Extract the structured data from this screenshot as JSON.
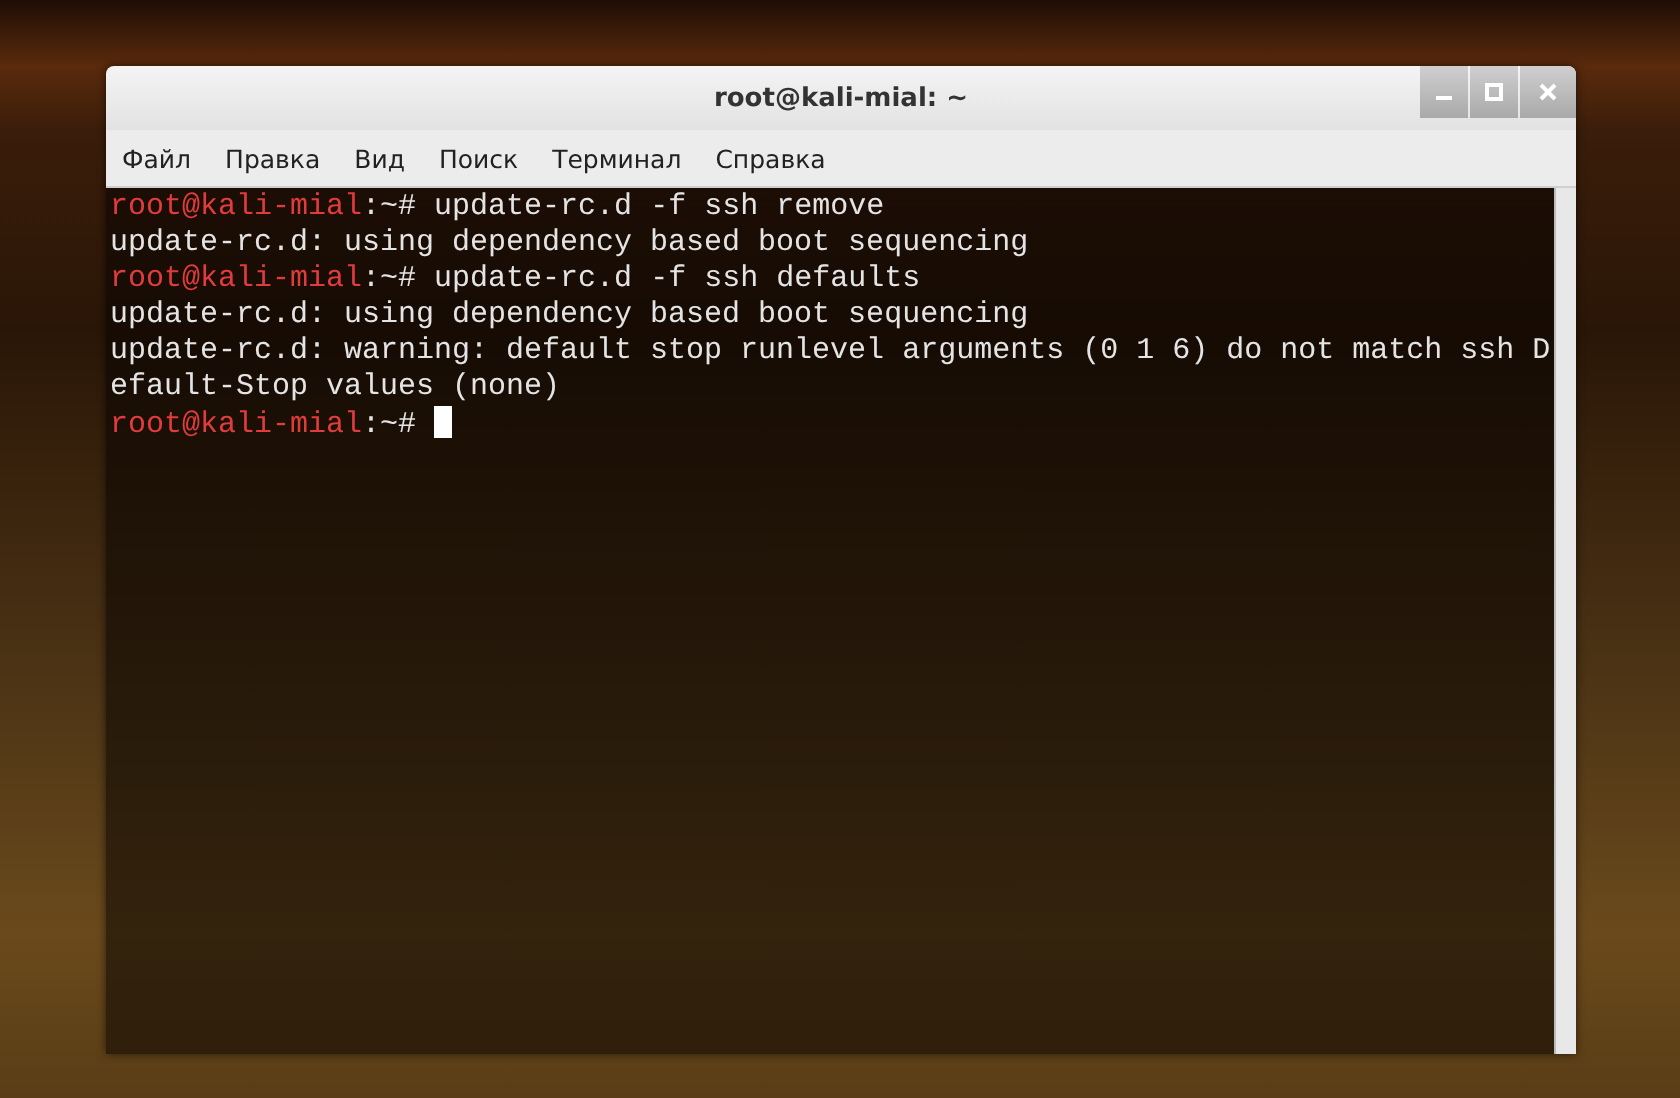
{
  "window": {
    "title": "root@kali-mial: ~"
  },
  "menu": [
    "Файл",
    "Правка",
    "Вид",
    "Поиск",
    "Терминал",
    "Справка"
  ],
  "terminal": {
    "lines": [
      {
        "kind": "prompt",
        "user_host": "root@kali-mial",
        "path": ":~#",
        "command": "update-rc.d -f ssh remove",
        "cursor": false
      },
      {
        "kind": "output",
        "text": "update-rc.d: using dependency based boot sequencing"
      },
      {
        "kind": "prompt",
        "user_host": "root@kali-mial",
        "path": ":~#",
        "command": "update-rc.d -f ssh defaults",
        "cursor": false
      },
      {
        "kind": "output",
        "text": "update-rc.d: using dependency based boot sequencing"
      },
      {
        "kind": "output",
        "text": "update-rc.d: warning: default stop runlevel arguments (0 1 6) do not match ssh D"
      },
      {
        "kind": "output",
        "text": "efault-Stop values (none)"
      },
      {
        "kind": "prompt",
        "user_host": "root@kali-mial",
        "path": ":~#",
        "cursor": true
      }
    ]
  }
}
